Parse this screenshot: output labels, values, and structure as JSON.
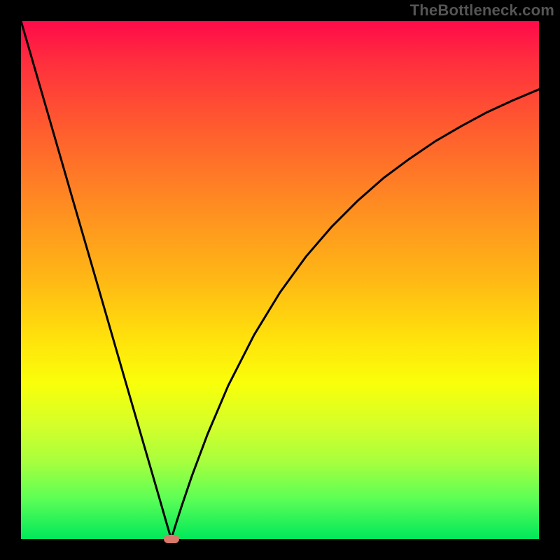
{
  "watermark": "TheBottleneck.com",
  "colors": {
    "frame": "#000000",
    "curve": "#000000",
    "marker": "#d9786b",
    "gradient_stops": [
      "#ff0a4a",
      "#ff2f3d",
      "#ff5a2f",
      "#ff8a22",
      "#ffb815",
      "#ffe40b",
      "#f9ff0a",
      "#d4ff2a",
      "#a8ff3d",
      "#5fff55",
      "#00e85a"
    ]
  },
  "chart_data": {
    "type": "line",
    "title": "",
    "xlabel": "",
    "ylabel": "",
    "xlim": [
      0,
      100
    ],
    "ylim": [
      0,
      100
    ],
    "grid": false,
    "legend": false,
    "annotations": [
      {
        "kind": "marker",
        "x": 29,
        "y": 0
      }
    ],
    "series": [
      {
        "name": "curve",
        "x": [
          0,
          5,
          10,
          15,
          20,
          25,
          27,
          28,
          29,
          30,
          31,
          33,
          36,
          40,
          45,
          50,
          55,
          60,
          65,
          70,
          75,
          80,
          85,
          90,
          95,
          100
        ],
        "y": [
          100,
          82.8,
          65.5,
          48.3,
          31.0,
          13.8,
          6.9,
          3.4,
          0,
          3.2,
          6.3,
          12.2,
          20.2,
          29.6,
          39.4,
          47.6,
          54.5,
          60.3,
          65.3,
          69.7,
          73.4,
          76.8,
          79.7,
          82.4,
          84.7,
          86.8
        ]
      }
    ]
  }
}
